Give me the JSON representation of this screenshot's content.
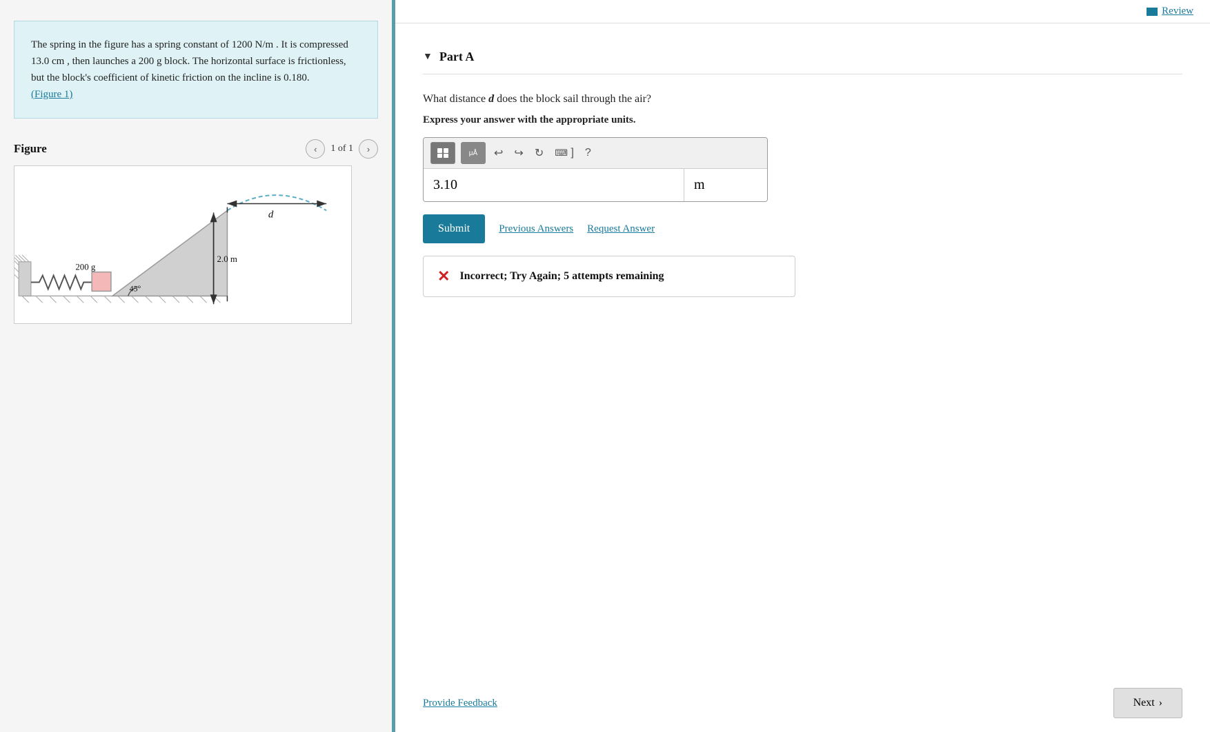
{
  "header": {
    "review_label": "Review"
  },
  "problem": {
    "text_1": "The spring in the figure has a spring constant of 1200",
    "units_1": "N/m",
    "text_2": ". It is compressed 13.0",
    "units_2": "cm",
    "text_3": ", then launches a 200 g block. The horizontal surface is frictionless, but the block's coefficient of kinetic friction on the incline is 0.180.",
    "figure_link": "(Figure 1)"
  },
  "figure": {
    "title": "Figure",
    "counter": "1 of 1",
    "prev_label": "‹",
    "next_label": "›"
  },
  "part": {
    "title": "Part A",
    "arrow": "▼"
  },
  "question": {
    "text_before": "What distance",
    "variable": "d",
    "text_after": "does the block sail through the air?",
    "express_text": "Express your answer with the appropriate units."
  },
  "toolbar": {
    "matrix_icon": "⊞",
    "mu_label": "μÅ",
    "undo_icon": "↩",
    "redo_icon": "↪",
    "refresh_icon": "↻",
    "keyboard_icon": "⌨",
    "bracket": "]",
    "help_icon": "?"
  },
  "answer": {
    "value": "3.10",
    "unit": "m",
    "value_placeholder": "",
    "unit_placeholder": ""
  },
  "actions": {
    "submit_label": "Submit",
    "previous_answers_label": "Previous Answers",
    "request_answer_label": "Request Answer"
  },
  "feedback": {
    "icon": "✕",
    "text": "Incorrect; Try Again; 5 attempts remaining"
  },
  "footer": {
    "provide_feedback_label": "Provide Feedback",
    "next_label": "Next",
    "next_arrow": "›"
  }
}
